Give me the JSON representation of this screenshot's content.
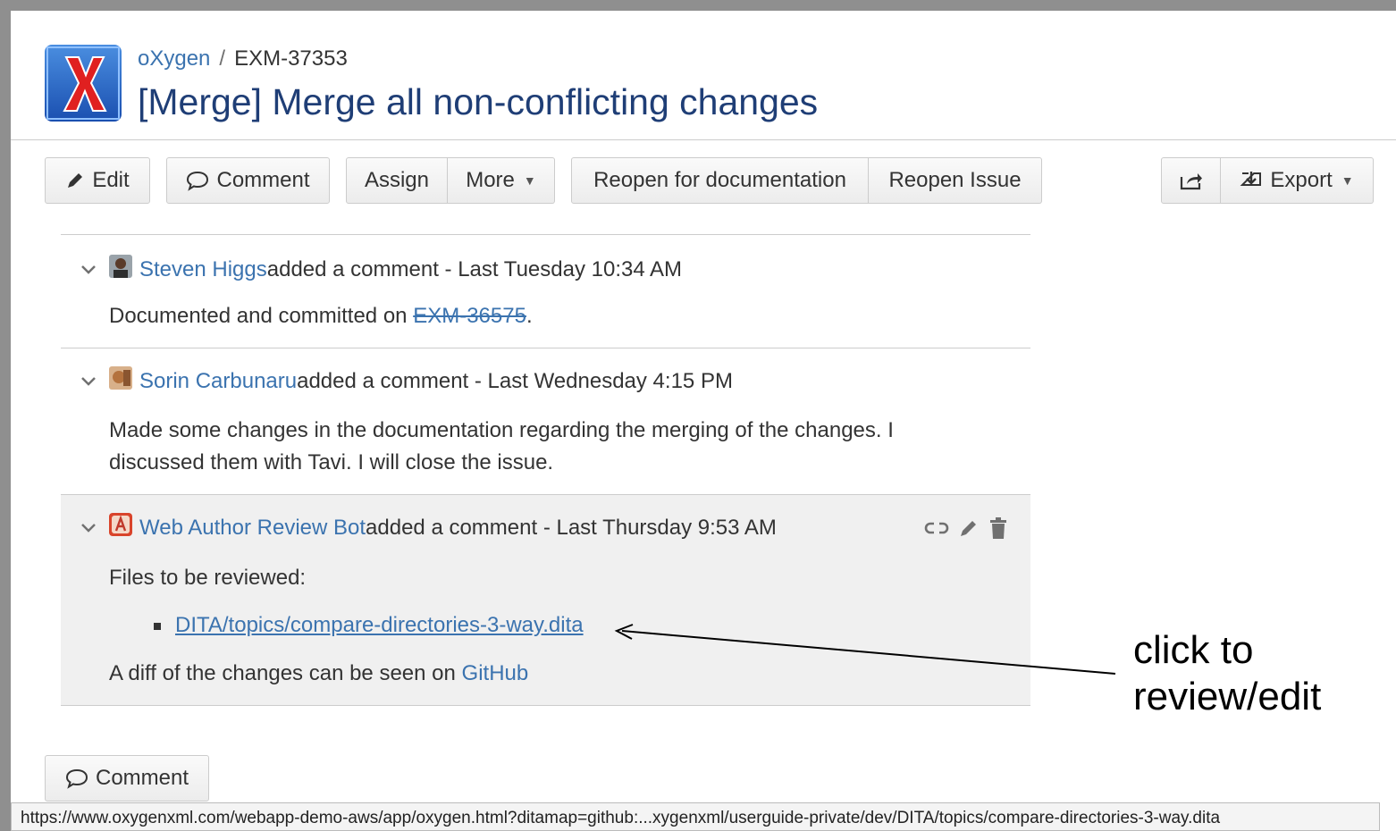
{
  "header": {
    "project": "oXygen",
    "separator": "/",
    "issue_key": "EXM-37353",
    "title": "[Merge] Merge all non-conflicting changes"
  },
  "toolbar": {
    "edit": "Edit",
    "comment": "Comment",
    "assign": "Assign",
    "more": "More",
    "reopen_doc": "Reopen for documentation",
    "reopen_issue": "Reopen Issue",
    "export": "Export"
  },
  "comments": [
    {
      "author": "Steven Higgs",
      "meta": " added a comment - Last Tuesday 10:34 AM",
      "body_prefix": "Documented and committed on ",
      "body_link": "EXM-36575",
      "body_suffix": "."
    },
    {
      "author": "Sorin Carbunaru",
      "meta": " added a comment - Last Wednesday 4:15 PM",
      "body_line1": "Made some changes in the documentation regarding the merging of the changes. I",
      "body_line2": "discussed them with Tavi. I will close the issue."
    },
    {
      "author": "Web Author Review Bot",
      "meta": " added a comment - Last Thursday 9:53 AM",
      "files_label": "Files to be reviewed:",
      "file": "DITA/topics/compare-directories-3-way.dita",
      "diff_prefix": "A diff of the changes can be seen on ",
      "diff_link": "GitHub"
    }
  ],
  "annotation": {
    "line1": "click to",
    "line2": "review/edit"
  },
  "footer": {
    "comment": "Comment",
    "status_url": "https://www.oxygenxml.com/webapp-demo-aws/app/oxygen.html?ditamap=github:...xygenxml/userguide-private/dev/DITA/topics/compare-directories-3-way.dita"
  },
  "colors": {
    "link": "#3b73af",
    "title": "#1f3e76",
    "active_comment_bg": "#f0f0f0"
  }
}
